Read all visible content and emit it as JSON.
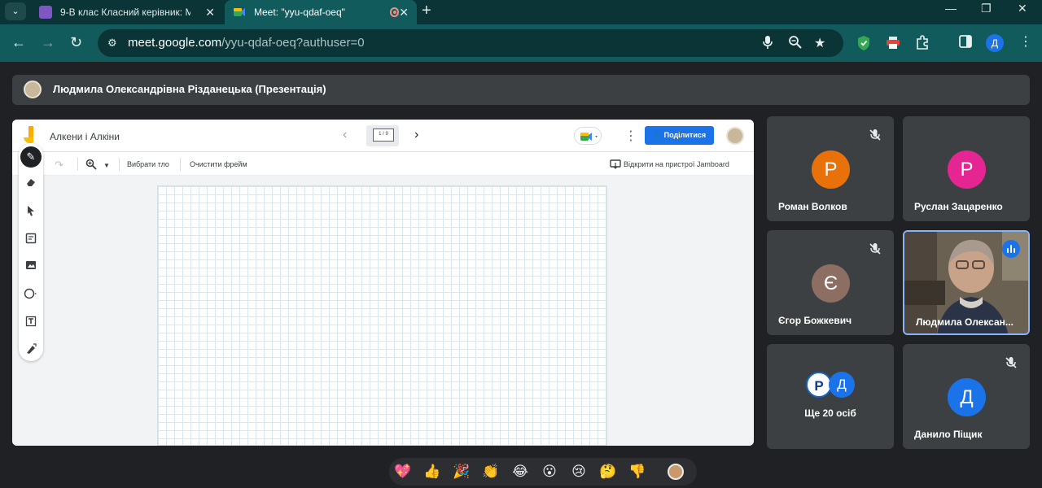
{
  "browser": {
    "tabs": [
      {
        "title": "9-В клас Класний керівник: М",
        "favicon_color": "#7e57c2",
        "active": false
      },
      {
        "title": "Meet: \"yyu-qdaf-oeq\"",
        "favicon_color": "#1e8e3e",
        "active": true
      }
    ],
    "new_tab": "+",
    "url_host": "meet.google.com",
    "url_path": "/yyu-qdaf-oeq?authuser=0",
    "profile_initial": "Д"
  },
  "meet": {
    "presenter_label": "Людмила Олександрівна Різданецька (Презентація)",
    "jamboard": {
      "title": "Алкени і Алкіни",
      "frame_indicator": "1 / 9",
      "share_label": "Поділитися",
      "set_background": "Вибрати тло",
      "clear_frame": "Очистити фрейм",
      "open_on_device": "Відкрити на пристрої Jamboard",
      "accent": "#1a73e8"
    },
    "participants": [
      {
        "name": "Роман Волков",
        "initial": "Р",
        "color": "#e8710a",
        "muted": true
      },
      {
        "name": "Руслан Зацаренко",
        "initial": "Р",
        "color": "#e52592",
        "muted": false
      },
      {
        "name": "Єгор Божкевич",
        "initial": "Є",
        "color": "#8d6e63",
        "muted": true
      },
      {
        "name": "Людмила Олексан...",
        "initial": "",
        "color": "#5a5146",
        "muted": false,
        "speaking": true
      },
      {
        "name": "Данило Піщик",
        "initial": "Д",
        "color": "#1a73e8",
        "muted": true
      }
    ],
    "more_tile": {
      "label": "Ще 20 осіб",
      "avatars": [
        "Р",
        "Д"
      ],
      "colors": [
        "#1565c0",
        "#1a73e8"
      ]
    },
    "reactions": [
      "💖",
      "👍",
      "🎉",
      "👏",
      "😂",
      "😮",
      "😢",
      "🤔",
      "👎"
    ]
  }
}
